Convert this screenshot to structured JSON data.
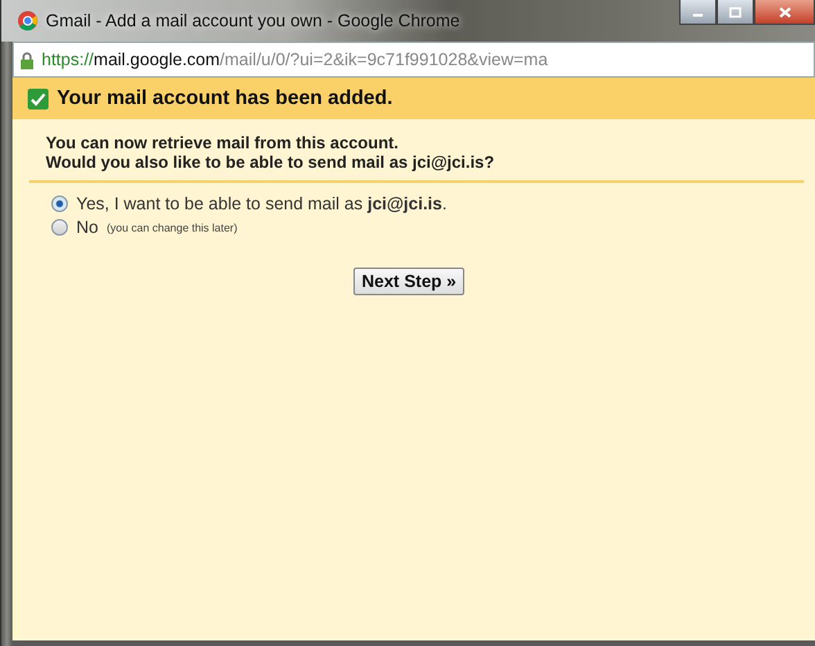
{
  "window": {
    "title": "Gmail - Add a mail account you own - Google Chrome",
    "controls": [
      {
        "kind": "minimize"
      },
      {
        "kind": "maximize"
      },
      {
        "kind": "close"
      }
    ]
  },
  "address_bar": {
    "scheme": "https://",
    "host": "mail.google.com",
    "path": "/mail/u/0/?ui=2&ik=9c71f991028&view=ma"
  },
  "banner": {
    "checked": true,
    "title": "Your mail account has been added."
  },
  "message": [
    "You can now retrieve mail from this account.",
    "Would you also like to be able to send mail as jci@jci.is?"
  ],
  "options": [
    {
      "label": "Yes, I want to be able to send mail as **jci@jci.is**.",
      "selected": true
    },
    {
      "label": "No",
      "note": "(you can change this later)",
      "selected": false
    }
  ],
  "button": "Next Step »"
}
